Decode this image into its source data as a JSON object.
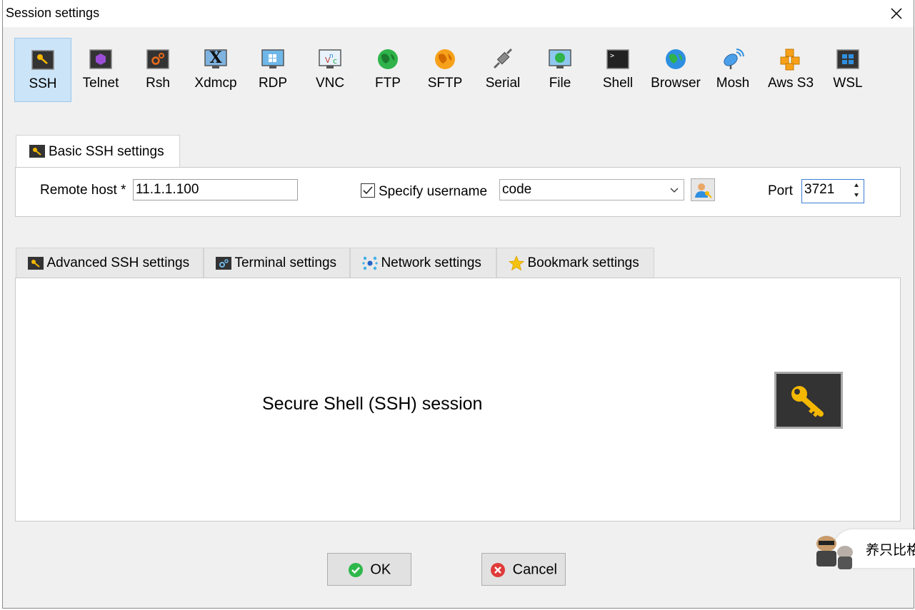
{
  "window": {
    "title": "Session settings"
  },
  "protocols": [
    {
      "label": "SSH",
      "icon": "ssh-key-icon",
      "active": true
    },
    {
      "label": "Telnet",
      "icon": "telnet-icon"
    },
    {
      "label": "Rsh",
      "icon": "rsh-gears-icon"
    },
    {
      "label": "Xdmcp",
      "icon": "xdmcp-x-icon"
    },
    {
      "label": "RDP",
      "icon": "rdp-monitor-icon"
    },
    {
      "label": "VNC",
      "icon": "vnc-icon"
    },
    {
      "label": "FTP",
      "icon": "ftp-globe-icon"
    },
    {
      "label": "SFTP",
      "icon": "sftp-globe-icon"
    },
    {
      "label": "Serial",
      "icon": "serial-plug-icon"
    },
    {
      "label": "File",
      "icon": "file-monitor-icon"
    },
    {
      "label": "Shell",
      "icon": "shell-terminal-icon"
    },
    {
      "label": "Browser",
      "icon": "browser-globe-icon"
    },
    {
      "label": "Mosh",
      "icon": "mosh-satellite-icon"
    },
    {
      "label": "Aws S3",
      "icon": "aws-s3-cubes-icon"
    },
    {
      "label": "WSL",
      "icon": "wsl-windows-icon"
    }
  ],
  "basic": {
    "tab_label": "Basic SSH settings",
    "remote_host_label": "Remote host *",
    "remote_host_value": "11.1.1.100",
    "specify_username_label": "Specify username",
    "specify_username_checked": true,
    "username_value": "code",
    "port_label": "Port",
    "port_value": "3721"
  },
  "advanced_tabs": [
    {
      "label": "Advanced SSH settings",
      "icon": "ssh-key-icon"
    },
    {
      "label": "Terminal settings",
      "icon": "terminal-gears-icon"
    },
    {
      "label": "Network settings",
      "icon": "network-nodes-icon"
    },
    {
      "label": "Bookmark settings",
      "icon": "star-icon"
    }
  ],
  "panel": {
    "description": "Secure Shell (SSH) session"
  },
  "buttons": {
    "ok": "OK",
    "cancel": "Cancel"
  },
  "overlay": {
    "text": "养只比格"
  },
  "colors": {
    "active_tab_bg": "#cce4f7",
    "key_yellow": "#f5b800",
    "ok_green": "#2eb84b",
    "cancel_red": "#e03a3a"
  }
}
